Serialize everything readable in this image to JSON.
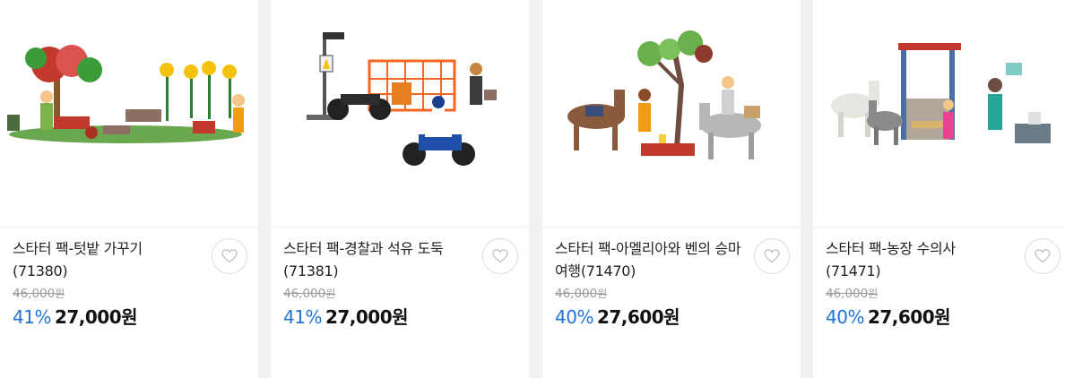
{
  "products": [
    {
      "title": "스타터 팩-텃밭 가꾸기 (71380)",
      "original_price": "46,000",
      "currency": "원",
      "discount_rate": "41%",
      "sale_price": "27,000원",
      "image": "garden-playset-image"
    },
    {
      "title": "스타터 팩-경찰과 석유 도둑 (71381)",
      "original_price": "46,000",
      "currency": "원",
      "discount_rate": "41%",
      "sale_price": "27,000원",
      "image": "police-motorbike-playset-image"
    },
    {
      "title": "스타터 팩-아멜리아와 벤의 승마 여행(71470)",
      "original_price": "46,000",
      "currency": "원",
      "discount_rate": "40%",
      "sale_price": "27,600원",
      "image": "horse-riding-playset-image"
    },
    {
      "title": "스타터 팩-농장 수의사 (71471)",
      "original_price": "46,000",
      "currency": "원",
      "discount_rate": "40%",
      "sale_price": "27,600원",
      "image": "farm-vet-playset-image"
    }
  ],
  "wishlist_icon": "heart-outline-icon",
  "colors": {
    "discount": "#1f73d6",
    "price": "#111111",
    "original": "#9a9a9a"
  }
}
